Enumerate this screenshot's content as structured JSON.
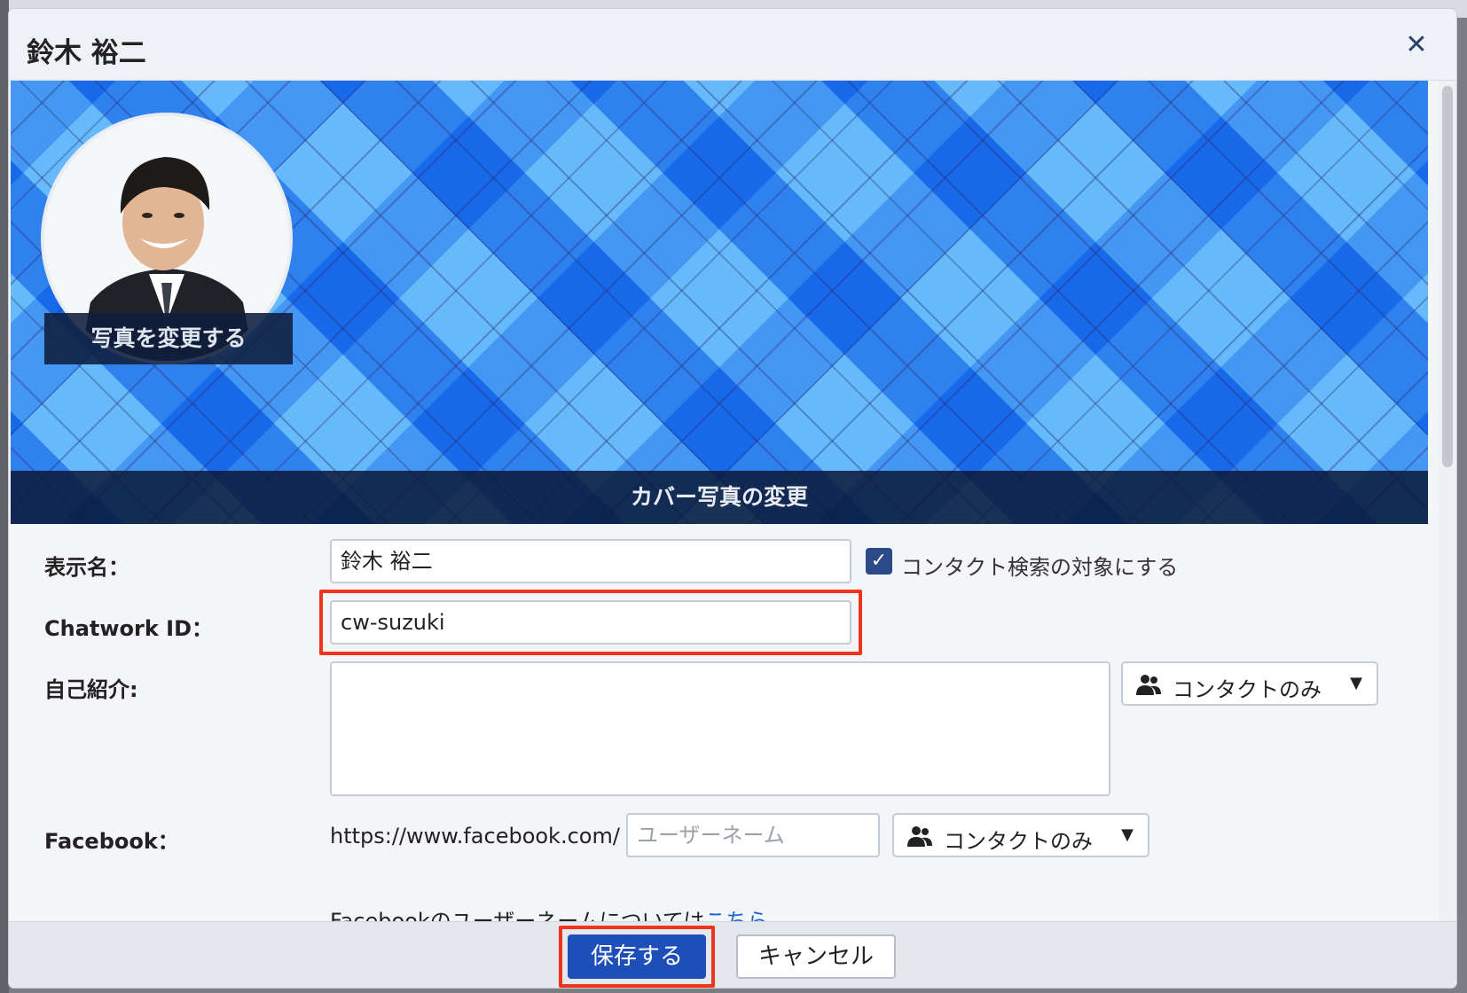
{
  "dialog": {
    "title": "鈴木 裕二",
    "close_icon": "close-icon"
  },
  "cover": {
    "change_cover_label": "カバー写真の変更",
    "change_photo_label": "写真を変更する"
  },
  "form": {
    "display_name": {
      "label": "表示名：",
      "value": "鈴木 裕二",
      "checkbox_checked": true,
      "checkbox_label": "コンタクト検索の対象にする"
    },
    "chatwork_id": {
      "label": "Chatwork ID：",
      "value": "cw-suzuki"
    },
    "self_intro": {
      "label": "自己紹介:",
      "value": "",
      "visibility": "コンタクトのみ"
    },
    "facebook": {
      "label": "Facebook：",
      "url_prefix": "https://www.facebook.com/",
      "placeholder": "ユーザーネーム",
      "visibility": "コンタクトのみ",
      "note_text": "Facebookのユーザーネームについては",
      "note_link": "こちら"
    }
  },
  "footer": {
    "save_label": "保存する",
    "cancel_label": "キャンセル"
  },
  "colors": {
    "primary_button": "#1e4fb8",
    "highlight": "#f0341c",
    "checkbox": "#2b4a87",
    "link": "#1b66d0"
  }
}
